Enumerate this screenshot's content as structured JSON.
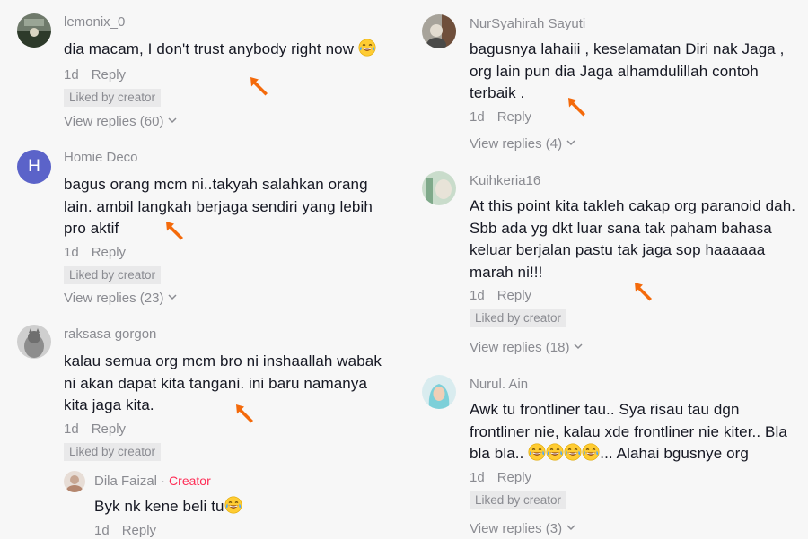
{
  "left": [
    {
      "username": "lemonix_0",
      "text": "dia macam, I don't trust anybody right now",
      "emoji_after": "laughing-crying-emoji",
      "time": "1d",
      "reply_label": "Reply",
      "liked": "Liked by creator",
      "view_replies": "View replies (60)"
    },
    {
      "username": "Homie Deco",
      "avatar_letter": "H",
      "text": "bagus orang mcm ni..takyah salahkan orang lain. ambil langkah berjaga sendiri yang lebih pro aktif",
      "time": "1d",
      "reply_label": "Reply",
      "liked": "Liked by creator",
      "view_replies": "View replies (23)"
    },
    {
      "username": "raksasa gorgon",
      "text": "kalau semua org mcm bro ni inshaallah wabak ni akan dapat kita tangani. ini baru namanya kita jaga kita.",
      "time": "1d",
      "reply_label": "Reply",
      "liked": "Liked by creator",
      "reply": {
        "username": "Dila Faizal",
        "separator": "·",
        "creator_tag": "Creator",
        "text": "Byk nk kene beli tu",
        "emoji_after": "laughing-crying-emoji",
        "time": "1d",
        "reply_label": "Reply"
      }
    }
  ],
  "right": [
    {
      "username": "NurSyahirah Sayuti",
      "text": "bagusnya lahaiii , keselamatan Diri nak Jaga , org lain pun dia Jaga alhamdulillah contoh terbaik .",
      "time": "1d",
      "reply_label": "Reply",
      "view_replies": "View replies (4)"
    },
    {
      "username": "Kuihkeria16",
      "text": "At this point kita takleh cakap org paranoid dah. Sbb ada yg dkt luar sana tak paham bahasa keluar berjalan pastu tak jaga sop haaaaaa marah ni!!!",
      "time": "1d",
      "reply_label": "Reply",
      "liked": "Liked by creator",
      "view_replies": "View replies (18)"
    },
    {
      "username": "Nurul. Ain",
      "text_line1": "Awk tu frontliner tau.. Sya risau tau dgn frontliner nie, kalau xde frontliner nie kiter..",
      "text_pre": "Bla bla bla..",
      "text_post": "... Alahai bgusnye org",
      "time": "1d",
      "reply_label": "Reply",
      "liked": "Liked by creator",
      "view_replies": "View replies (3)"
    }
  ],
  "colors": {
    "background": "#f7f7f7",
    "text": "#161823",
    "muted": "#8a8b91",
    "creator": "#fe2c55",
    "avatar_h": "#5b63c9",
    "cursor": "#f46a0b"
  }
}
